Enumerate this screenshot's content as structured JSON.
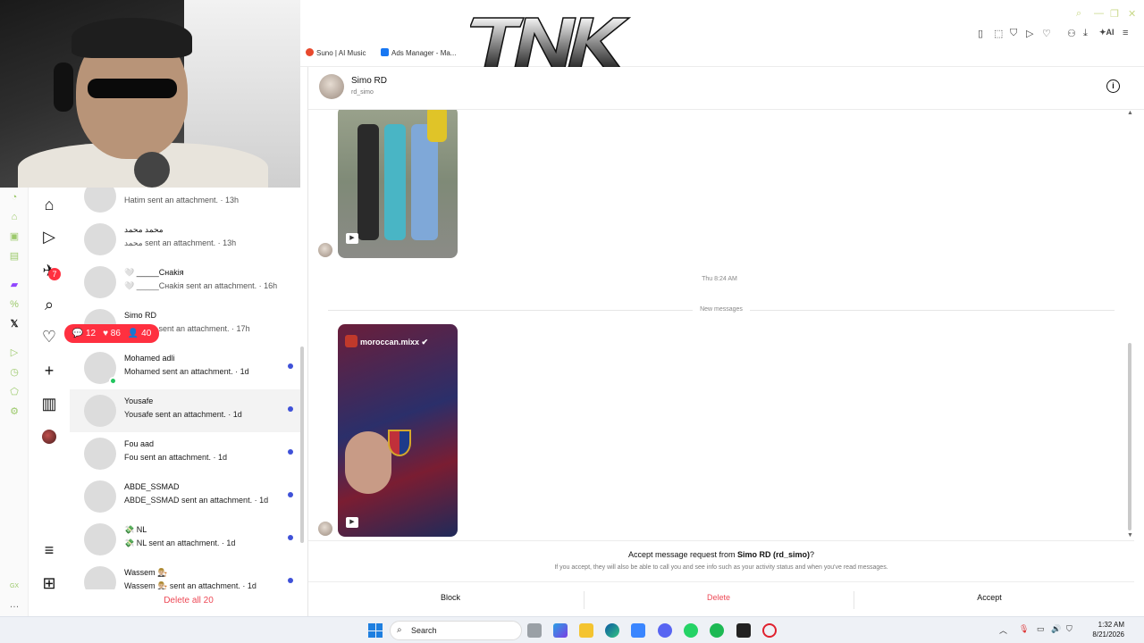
{
  "browser": {
    "bookmarks": [
      {
        "label": "Suno | AI Music",
        "color": "#e8492d"
      },
      {
        "label": "Ads Manager - Ma...",
        "color": "#1877f2"
      }
    ],
    "toolbar_ai_label": "AI",
    "logo_text": "TNK"
  },
  "nav": {
    "badge_count": "7"
  },
  "notifications": {
    "comments": "12",
    "likes": "86",
    "follows": "40"
  },
  "threads": [
    {
      "name": "",
      "preview": "Hatim sent an attachment. · 13h",
      "unread": false,
      "avatar": "blue"
    },
    {
      "name": "محمد محمد",
      "preview": "محمد sent an attachment. · 13h",
      "unread": false,
      "avatar": "sketch"
    },
    {
      "name": "🤍 _____Снаkiя",
      "preview": "🤍 _____Снаkiя sent an attachment. · 16h",
      "unread": false,
      "avatar": "green"
    },
    {
      "name": "Simo RD",
      "preview": "Simo RD sent an attachment. · 17h",
      "unread": false,
      "avatar": "blank"
    },
    {
      "name": "Mohamed adli",
      "preview": "Mohamed sent an attachment. · 1d",
      "unread": true,
      "avatar": "green"
    },
    {
      "name": "Yousafe",
      "preview": "Yousafe sent an attachment. · 1d",
      "unread": true,
      "avatar": "dark"
    },
    {
      "name": "Fou aad",
      "preview": "Fou sent an attachment. · 1d",
      "unread": true,
      "avatar": "blank"
    },
    {
      "name": "ABDE_SSMAD",
      "preview": "ABDE_SSMAD sent an attachment. · 1d",
      "unread": true,
      "avatar": "blank"
    },
    {
      "name": "💸 NL",
      "preview": "💸 NL sent an attachment. · 1d",
      "unread": true,
      "avatar": "blank"
    },
    {
      "name": "Wassem 👨🏼‍⚖️",
      "preview": "Wassem 👨🏼‍⚖️ sent an attachment. · 1d",
      "unread": true,
      "avatar": "green"
    }
  ],
  "delete_all_label": "Delete all 20",
  "chat": {
    "name": "Simo RD",
    "username": "rd_simo",
    "timestamp": "Thu 8:24 AM",
    "new_messages_label": "New messages",
    "reel_account": "moroccan.mixx"
  },
  "request": {
    "title_prefix": "Accept message request from ",
    "title_name": "Simo RD (rd_simo)",
    "title_suffix": "?",
    "subtitle": "If you accept, they will also be able to call you and see info such as your activity status and when you've read messages.",
    "block_label": "Block",
    "delete_label": "Delete",
    "accept_label": "Accept"
  },
  "taskbar": {
    "search_label": "Search",
    "time": "1:32 AM",
    "date": "8/21/2026"
  },
  "colors": {
    "accent_red": "#ed4956",
    "unread_dot": "#3f51d8",
    "notif_red": "#ff3040"
  }
}
